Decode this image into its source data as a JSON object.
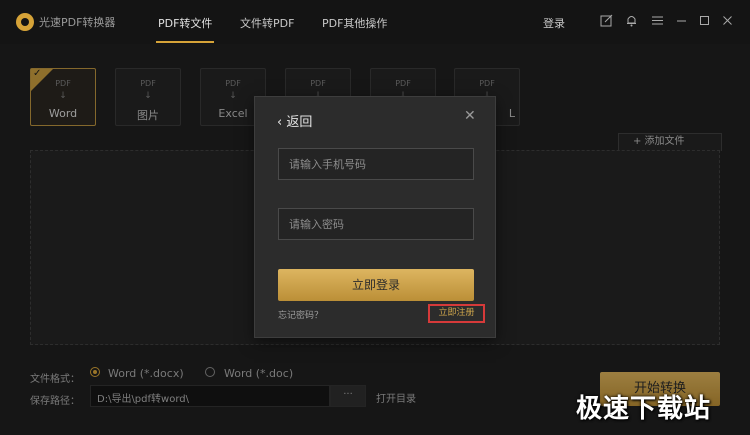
{
  "app": {
    "title": "光速PDF转换器"
  },
  "nav": {
    "tabs": [
      {
        "label": "PDF转文件",
        "active": true
      },
      {
        "label": "文件转PDF",
        "active": false
      },
      {
        "label": "PDF其他操作",
        "active": false
      }
    ],
    "login_label": "登录"
  },
  "titlebar_icons": [
    "edit-icon",
    "bell-icon",
    "menu-icon",
    "minimize-icon",
    "maximize-icon",
    "close-icon"
  ],
  "tiles": [
    {
      "pdf": "PDF",
      "format": "Word",
      "selected": true
    },
    {
      "pdf": "PDF",
      "format": "图片",
      "selected": false
    },
    {
      "pdf": "PDF",
      "format": "Excel",
      "selected": false
    },
    {
      "pdf": "PDF",
      "format": "",
      "selected": false
    },
    {
      "pdf": "PDF",
      "format": "",
      "selected": false
    },
    {
      "pdf": "PDF",
      "format": "L",
      "selected": false
    }
  ],
  "add_file_label": "+ 添加文件",
  "options": {
    "format_label": "文件格式：",
    "format_options": [
      {
        "label": "Word (*.docx)",
        "checked": true
      },
      {
        "label": "Word (*.doc)",
        "checked": false
      }
    ],
    "save_path_label": "保存路径：",
    "save_path_value": "D:\\导出\\pdf转word\\",
    "browse_label": "···",
    "open_dir_label": "打开目录",
    "start_label": "开始转换"
  },
  "modal": {
    "back_label": "返回",
    "phone_placeholder": "请输入手机号码",
    "password_placeholder": "请输入密码",
    "login_button": "立即登录",
    "forgot_label": "忘记密码？",
    "register_label": "立即注册"
  },
  "watermark": "极速下载站",
  "colors": {
    "accent": "#d6a338",
    "highlight_box": "#d63a3a",
    "background": "#1f1f1f"
  }
}
